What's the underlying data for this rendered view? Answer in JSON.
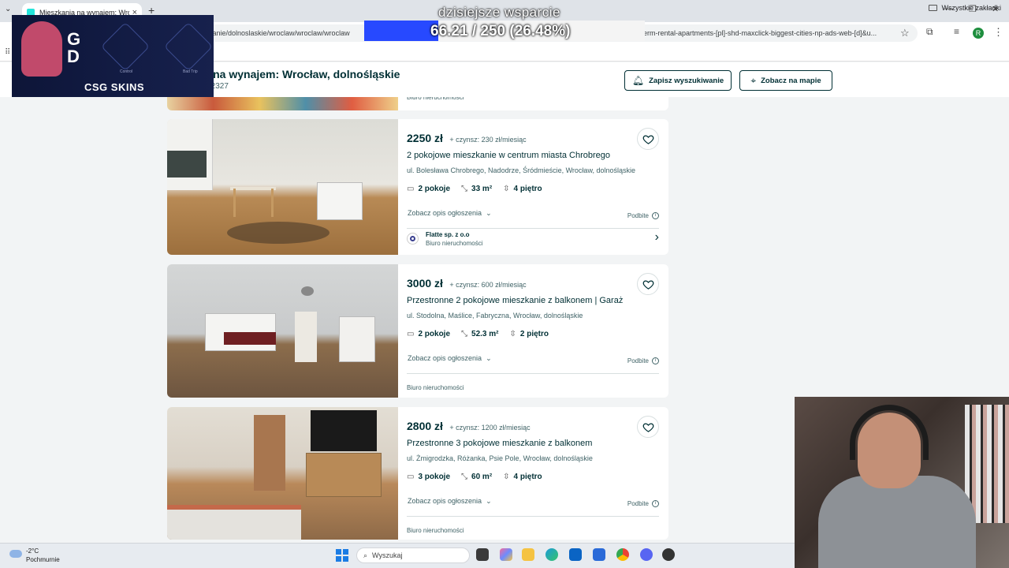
{
  "browser": {
    "tab_title": "Mieszkania na wynajem: Wrocław",
    "url_part_1": "szkanie/dolnoslaskie/wroclaw/wroclaw/wroclaw",
    "url_part_2": "erm-rental-apartments-[pl]-shd-maxclick-biggest-cities-np-ads-web-[d]&u...",
    "profile_initial": "R",
    "bookmarks_all": "Wszystkie zakładki"
  },
  "page": {
    "title": "nia na wynajem: Wrocław, dolnośląskie",
    "subtitle": "eń z 2327",
    "save_search": "Zapisz wyszukiwanie",
    "view_map": "Zobacz na mapie",
    "top_card_agency": "Biuro nieruchomości"
  },
  "listings": [
    {
      "price": "2250 zł",
      "rent": "+ czynsz: 230 zł/miesiąc",
      "title": "2 pokojowe mieszkanie w centrum miasta Chrobrego",
      "address": "ul. Bolesława Chrobrego, Nadodrze, Śródmieście, Wrocław, dolnośląskie",
      "rooms": "2 pokoje",
      "area": "33 m²",
      "floor": "4 piętro",
      "description_link": "Zobacz opis ogłoszenia",
      "promoted": "Podbite",
      "agency_name": "Flatte sp. z o.o",
      "agency_type": "Biuro nieruchomości"
    },
    {
      "price": "3000 zł",
      "rent": "+ czynsz: 600 zł/miesiąc",
      "title": "Przestronne 2 pokojowe mieszkanie z balkonem | Garaż",
      "address": "ul. Stodolna, Maślice, Fabryczna, Wrocław, dolnośląskie",
      "rooms": "2 pokoje",
      "area": "52.3 m²",
      "floor": "2 piętro",
      "description_link": "Zobacz opis ogłoszenia",
      "promoted": "Podbite",
      "agency_type": "Biuro nieruchomości"
    },
    {
      "price": "2800 zł",
      "rent": "+ czynsz: 1200 zł/miesiąc",
      "title": "Przestronne 3 pokojowe mieszkanie z balkonem",
      "address": "ul. Żmigrodzka, Różanka, Psie Pole, Wrocław, dolnośląskie",
      "rooms": "3 pokoje",
      "area": "60 m²",
      "floor": "4 piętro",
      "description_link": "Zobacz opis ogłoszenia",
      "promoted": "Podbite",
      "agency_type": "Biuro nieruchomości"
    }
  ],
  "overlay": {
    "goal_title": "dzisiejsze wsparcie",
    "goal_text": "66.21 / 250 (26.48%)",
    "goal_fraction": 0.2648,
    "ad_brand": "CSG SKINS",
    "ad_gd": "G\nD",
    "ad_label_1": "Control",
    "ad_label_2": "Bad Trip"
  },
  "taskbar": {
    "temperature": "-2°C",
    "condition": "Pochmurnie",
    "search_placeholder": "Wyszukaj"
  },
  "colors": {
    "brand_dark": "#002f34",
    "goal_fill": "#2749ff",
    "page_bg": "#f2f4f5"
  }
}
